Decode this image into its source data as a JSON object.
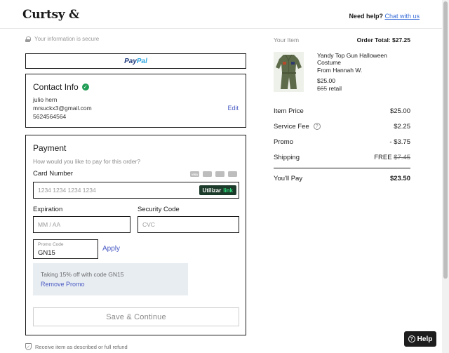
{
  "header": {
    "logo": "Curtsy",
    "need_help": "Need help?",
    "chat": "Chat with us"
  },
  "secure_text": "Your information is secure",
  "paypal": {
    "pay": "Pay",
    "pal": "Pal"
  },
  "contact": {
    "title": "Contact Info",
    "name": "julio hern",
    "email": "mrsuckx3@gmail.com",
    "phone": "5624564564",
    "edit": "Edit"
  },
  "payment": {
    "title": "Payment",
    "subtitle": "How would you like to pay for this order?",
    "card_number_label": "Card Number",
    "card_number_placeholder": "1234 1234 1234 1234",
    "card_brands": [
      "VISA",
      "MC",
      "AMEX",
      "DISC"
    ],
    "link_button": {
      "utilizar": "Utilizar",
      "link": "link"
    },
    "expiration_label": "Expiration",
    "expiration_placeholder": "MM / AA",
    "security_label": "Security Code",
    "security_placeholder": "CVC",
    "promo_label": "Promo Code",
    "promo_value": "GN15",
    "apply": "Apply",
    "promo_note": "Taking 15% off with code GN15",
    "remove_promo": "Remove Promo",
    "save": "Save & Continue"
  },
  "footer_note": "Receive item as described or full refund",
  "summary": {
    "your_item": "Your Item",
    "order_total": "Order Total: $27.25",
    "item_name": "Yandy Top Gun Halloween Costume",
    "item_from": "From Hannah W.",
    "item_price": "$25.00",
    "item_retail_price": "$65",
    "item_retail_word": "retail",
    "rows": [
      {
        "label": "Item Price",
        "value": "$25.00"
      },
      {
        "label": "Service Fee",
        "value": "$2.25"
      },
      {
        "label": "Promo",
        "value": "- $3.75"
      },
      {
        "label": "Shipping",
        "value": "FREE",
        "strike": "$7.45"
      }
    ],
    "total_label": "You'll Pay",
    "total_value": "$23.50"
  },
  "help_button": "Help",
  "colors": {
    "link": "#4a5bc4",
    "success": "#1f9d55",
    "accent_link_btn": "#1d3b2a"
  }
}
